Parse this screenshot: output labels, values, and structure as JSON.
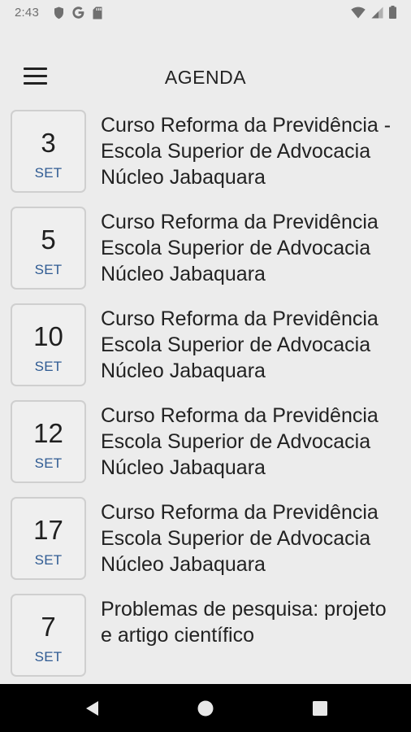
{
  "status_bar": {
    "time": "2:43",
    "left_icons": [
      "shield-icon",
      "google-icon",
      "sd-card-icon"
    ],
    "right_icons": [
      "wifi-icon",
      "cell-signal-icon",
      "battery-icon"
    ]
  },
  "app_bar": {
    "title": "AGENDA",
    "menu_icon": "hamburger-menu-icon"
  },
  "events": [
    {
      "day": "3",
      "month": "SET",
      "title": "Curso Reforma da Previdência - Escola Superior de Advocacia Núcleo Jabaquara"
    },
    {
      "day": "5",
      "month": "SET",
      "title": "Curso Reforma da Previdência Escola Superior de Advocacia Núcleo Jabaquara"
    },
    {
      "day": "10",
      "month": "SET",
      "title": "Curso Reforma da Previdência Escola Superior de Advocacia Núcleo Jabaquara"
    },
    {
      "day": "12",
      "month": "SET",
      "title": "Curso Reforma da Previdência Escola Superior de Advocacia Núcleo Jabaquara"
    },
    {
      "day": "17",
      "month": "SET",
      "title": "Curso Reforma da Previdência Escola Superior de Advocacia Núcleo Jabaquara"
    },
    {
      "day": "7",
      "month": "SET",
      "title": "Problemas de pesquisa: projeto e artigo científico"
    }
  ],
  "colors": {
    "background": "#ececec",
    "month_text": "#2f5b93",
    "status_icons": "#6f6f6f",
    "nav_bar": "#000000"
  },
  "nav_bar": {
    "buttons": [
      "back-icon",
      "home-icon",
      "recents-icon"
    ]
  }
}
